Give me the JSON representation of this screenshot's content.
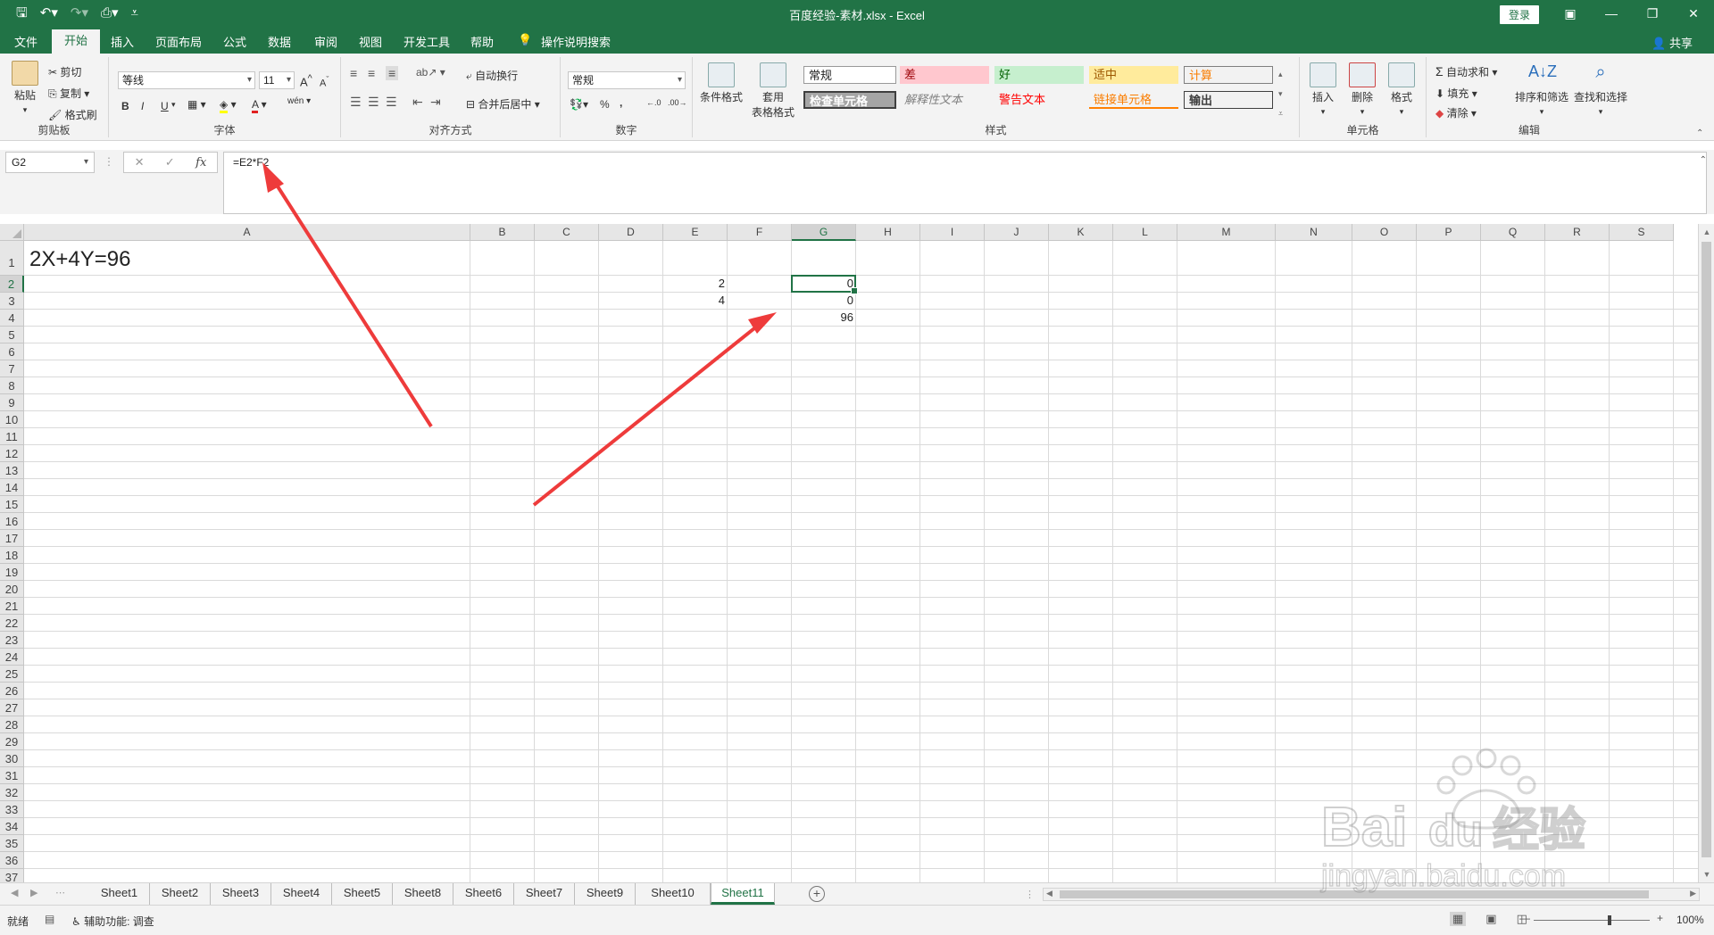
{
  "app": {
    "window_title": "百度经验-素材.xlsx  -  Excel",
    "login_label": "登录",
    "share_label": "共享"
  },
  "tabs": [
    "文件",
    "开始",
    "插入",
    "页面布局",
    "公式",
    "数据",
    "审阅",
    "视图",
    "开发工具",
    "帮助"
  ],
  "active_tab": "开始",
  "tell_me": "操作说明搜索",
  "ribbon": {
    "clipboard": {
      "paste": "粘贴",
      "cut": "剪切",
      "copy": "复制",
      "format_painter": "格式刷",
      "group": "剪贴板"
    },
    "font": {
      "name": "等线",
      "size": "11",
      "bold": "B",
      "italic": "I",
      "underline": "U",
      "grow": "A",
      "shrink": "A",
      "color_a": "A",
      "phonetic": "wén",
      "group": "字体"
    },
    "alignment": {
      "wrap": "自动换行",
      "merge": "合并后居中",
      "group": "对齐方式"
    },
    "number": {
      "format": "常规",
      "percent": "%",
      "comma": ",",
      "group": "数字"
    },
    "styles": {
      "conditional": "条件格式",
      "table": "套用\n表格格式",
      "table_line1": "套用",
      "table_line2": "表格格式",
      "cells": [
        "常规",
        "差",
        "好",
        "适中",
        "计算",
        "检查单元格",
        "解释性文本",
        "警告文本",
        "链接单元格",
        "输出"
      ],
      "group": "样式"
    },
    "cells": {
      "insert": "插入",
      "delete": "删除",
      "format": "格式",
      "group": "单元格"
    },
    "editing": {
      "autosum": "自动求和",
      "fill": "填充",
      "clear": "清除",
      "sort": "排序和筛选",
      "find": "查找和选择",
      "group": "编辑"
    }
  },
  "formula_bar": {
    "name_box": "G2",
    "cancel": "✕",
    "enter": "✓",
    "fx": "fx",
    "formula": "=E2*F2"
  },
  "columns": [
    "A",
    "B",
    "C",
    "D",
    "E",
    "F",
    "G",
    "H",
    "I",
    "J",
    "K",
    "L",
    "M",
    "N",
    "O",
    "P",
    "Q",
    "R",
    "S"
  ],
  "selected_column": "G",
  "selected_row": "2",
  "rows": [
    "1",
    "2",
    "3",
    "4",
    "5",
    "6",
    "7",
    "8",
    "9",
    "10",
    "11",
    "12",
    "13",
    "14",
    "15",
    "16",
    "17",
    "18",
    "19",
    "20",
    "21",
    "22",
    "23",
    "24",
    "25",
    "26",
    "27",
    "28",
    "29",
    "30",
    "31",
    "32",
    "33",
    "34",
    "35",
    "36",
    "37"
  ],
  "cells": {
    "A1": "2X+4Y=96",
    "E2": "2",
    "E3": "4",
    "G2": "0",
    "G3": "0",
    "G4": "96"
  },
  "sheets": [
    "Sheet1",
    "Sheet2",
    "Sheet3",
    "Sheet4",
    "Sheet5",
    "Sheet8",
    "Sheet6",
    "Sheet7",
    "Sheet9",
    "Sheet10",
    "Sheet11"
  ],
  "active_sheet": "Sheet11",
  "status": {
    "ready": "就绪",
    "accessibility": "辅助功能: 调查",
    "zoom": "100%"
  },
  "watermark": {
    "line1": "Bai",
    "line2": "du",
    "line3": "经验",
    "url": "jingyan.baidu.com"
  },
  "colors": {
    "excel_green": "#217346",
    "annotation_red": "#ee3b3b"
  }
}
